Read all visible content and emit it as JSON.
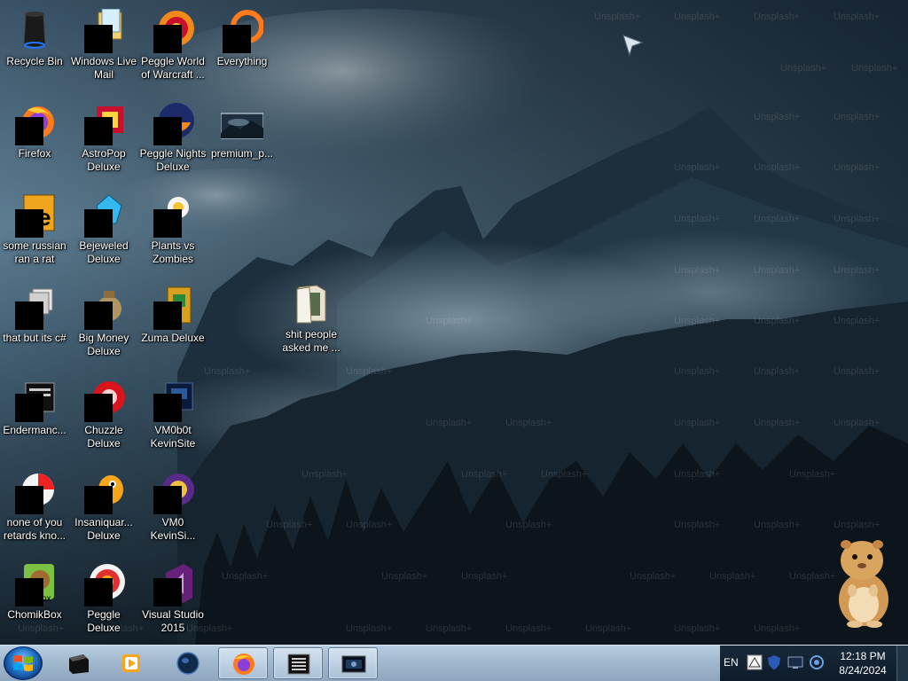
{
  "desktop": {
    "icons": [
      {
        "label": "Recycle Bin",
        "icon": "recycle-bin-icon"
      },
      {
        "label": "Windows Live Mail",
        "icon": "mail-icon"
      },
      {
        "label": "Peggle World of Warcraft ...",
        "icon": "game-icon"
      },
      {
        "label": "Everything",
        "icon": "search-icon"
      },
      {
        "label": "Firefox",
        "icon": "firefox-icon"
      },
      {
        "label": "AstroPop Deluxe",
        "icon": "game-icon"
      },
      {
        "label": "Peggle Nights Deluxe",
        "icon": "game-icon"
      },
      {
        "label": "premium_p...",
        "icon": "image-file-icon"
      },
      {
        "label": "some russian ran a rat",
        "icon": "app-icon"
      },
      {
        "label": "Bejeweled Deluxe",
        "icon": "game-icon"
      },
      {
        "label": "Plants vs Zombies",
        "icon": "game-icon"
      },
      {
        "label": "that but its c#",
        "icon": "app-icon"
      },
      {
        "label": "Big Money Deluxe",
        "icon": "game-icon"
      },
      {
        "label": "Zuma Deluxe",
        "icon": "game-icon"
      },
      {
        "label": "shit people asked me ...",
        "icon": "folder-icon"
      },
      {
        "label": "Endermanc...",
        "icon": "app-icon"
      },
      {
        "label": "Chuzzle Deluxe",
        "icon": "game-icon"
      },
      {
        "label": "VM0b0t KevinSite",
        "icon": "app-icon"
      },
      {
        "label": "none of you retards kno...",
        "icon": "app-icon"
      },
      {
        "label": "Insaniquar... Deluxe",
        "icon": "game-icon"
      },
      {
        "label": "VM0 KevinSi...",
        "icon": "app-icon"
      },
      {
        "label": "ChomikBox",
        "icon": "app-icon"
      },
      {
        "label": "Peggle Deluxe",
        "icon": "game-icon"
      },
      {
        "label": "Visual Studio 2015",
        "icon": "visual-studio-icon"
      }
    ],
    "wallpaper_watermark": "Unsplash+"
  },
  "taskbar": {
    "pinned": [
      {
        "name": "cmd-window-icon"
      },
      {
        "name": "media-player-icon"
      },
      {
        "name": "globe-icon"
      },
      {
        "name": "firefox-icon"
      },
      {
        "name": "terminal-icon"
      },
      {
        "name": "monitor-app-icon"
      }
    ],
    "language": "EN",
    "time": "12:18 PM",
    "date": "8/24/2024"
  },
  "colors": {
    "taskbar_top": "#b8cde0",
    "tray_bg": "#0d1b29",
    "mask": "#000000"
  }
}
